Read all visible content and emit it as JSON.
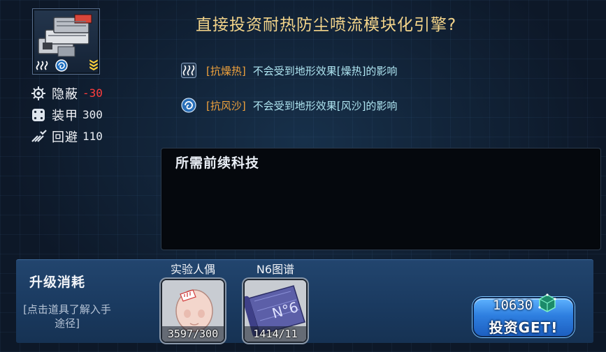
{
  "module": {
    "title": "直接投资耐热防尘喷流模块化引擎?",
    "thumbnail_icons": [
      "heat-waves-icon",
      "sand-swirl-icon",
      "rank-chevrons-icon"
    ]
  },
  "stats": [
    {
      "icon": "stealth-icon",
      "label": "隐蔽",
      "value": "-30",
      "negative": true
    },
    {
      "icon": "armor-icon",
      "label": "装甲",
      "value": "300",
      "negative": false
    },
    {
      "icon": "evasion-icon",
      "label": "回避",
      "value": "110",
      "negative": false
    }
  ],
  "effects": [
    {
      "icon": "heat-waves-icon",
      "tag": "[抗燥热]",
      "description": "不会受到地形效果[燥热]的影响"
    },
    {
      "icon": "sand-swirl-icon",
      "tag": "[抗风沙]",
      "description": "不会受到地形效果[风沙]的影响"
    }
  ],
  "prerequisites": {
    "title": "所需前续科技"
  },
  "upgrade": {
    "title": "升级消耗",
    "hint": "[点击道具了解入手途径]",
    "items": [
      {
        "name": "实验人偶",
        "count": "3597/300",
        "icon": "doll-head-icon"
      },
      {
        "name": "N6图谱",
        "count": "1414/11",
        "icon": "blueprint-scroll-icon"
      }
    ],
    "cost": "10630",
    "currency_icon": "data-cube-icon",
    "button_label": "投资GET!"
  },
  "colors": {
    "title": "#f3d48a",
    "tag": "#f0a23c",
    "effect_text": "#aee4f0",
    "negative_stat": "#ff3d3d",
    "button": "#2e7fe0"
  }
}
